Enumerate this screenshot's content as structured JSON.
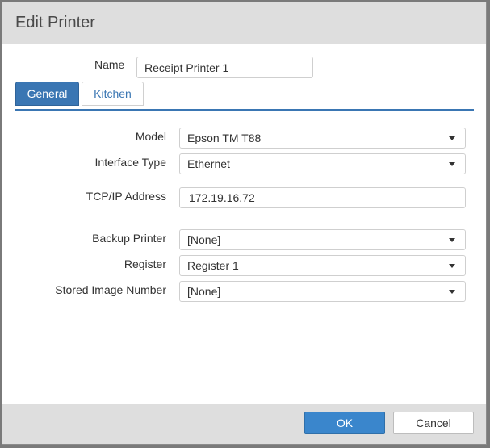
{
  "dialog": {
    "title": "Edit Printer"
  },
  "name_field": {
    "label": "Name",
    "value": "Receipt Printer 1"
  },
  "tabs": [
    {
      "label": "General",
      "active": true
    },
    {
      "label": "Kitchen",
      "active": false
    }
  ],
  "form": {
    "model": {
      "label": "Model",
      "value": "Epson TM T88"
    },
    "interface_type": {
      "label": "Interface Type",
      "value": "Ethernet"
    },
    "tcpip_address": {
      "label": "TCP/IP Address",
      "value": "172.19.16.72"
    },
    "backup_printer": {
      "label": "Backup Printer",
      "value": "[None]"
    },
    "register": {
      "label": "Register",
      "value": "Register 1"
    },
    "stored_image_number": {
      "label": "Stored Image Number",
      "value": "[None]"
    }
  },
  "buttons": {
    "ok": "OK",
    "cancel": "Cancel"
  },
  "colors": {
    "accent": "#3a76b3",
    "ok_button": "#3a86cc",
    "titlebar": "#dedede"
  }
}
